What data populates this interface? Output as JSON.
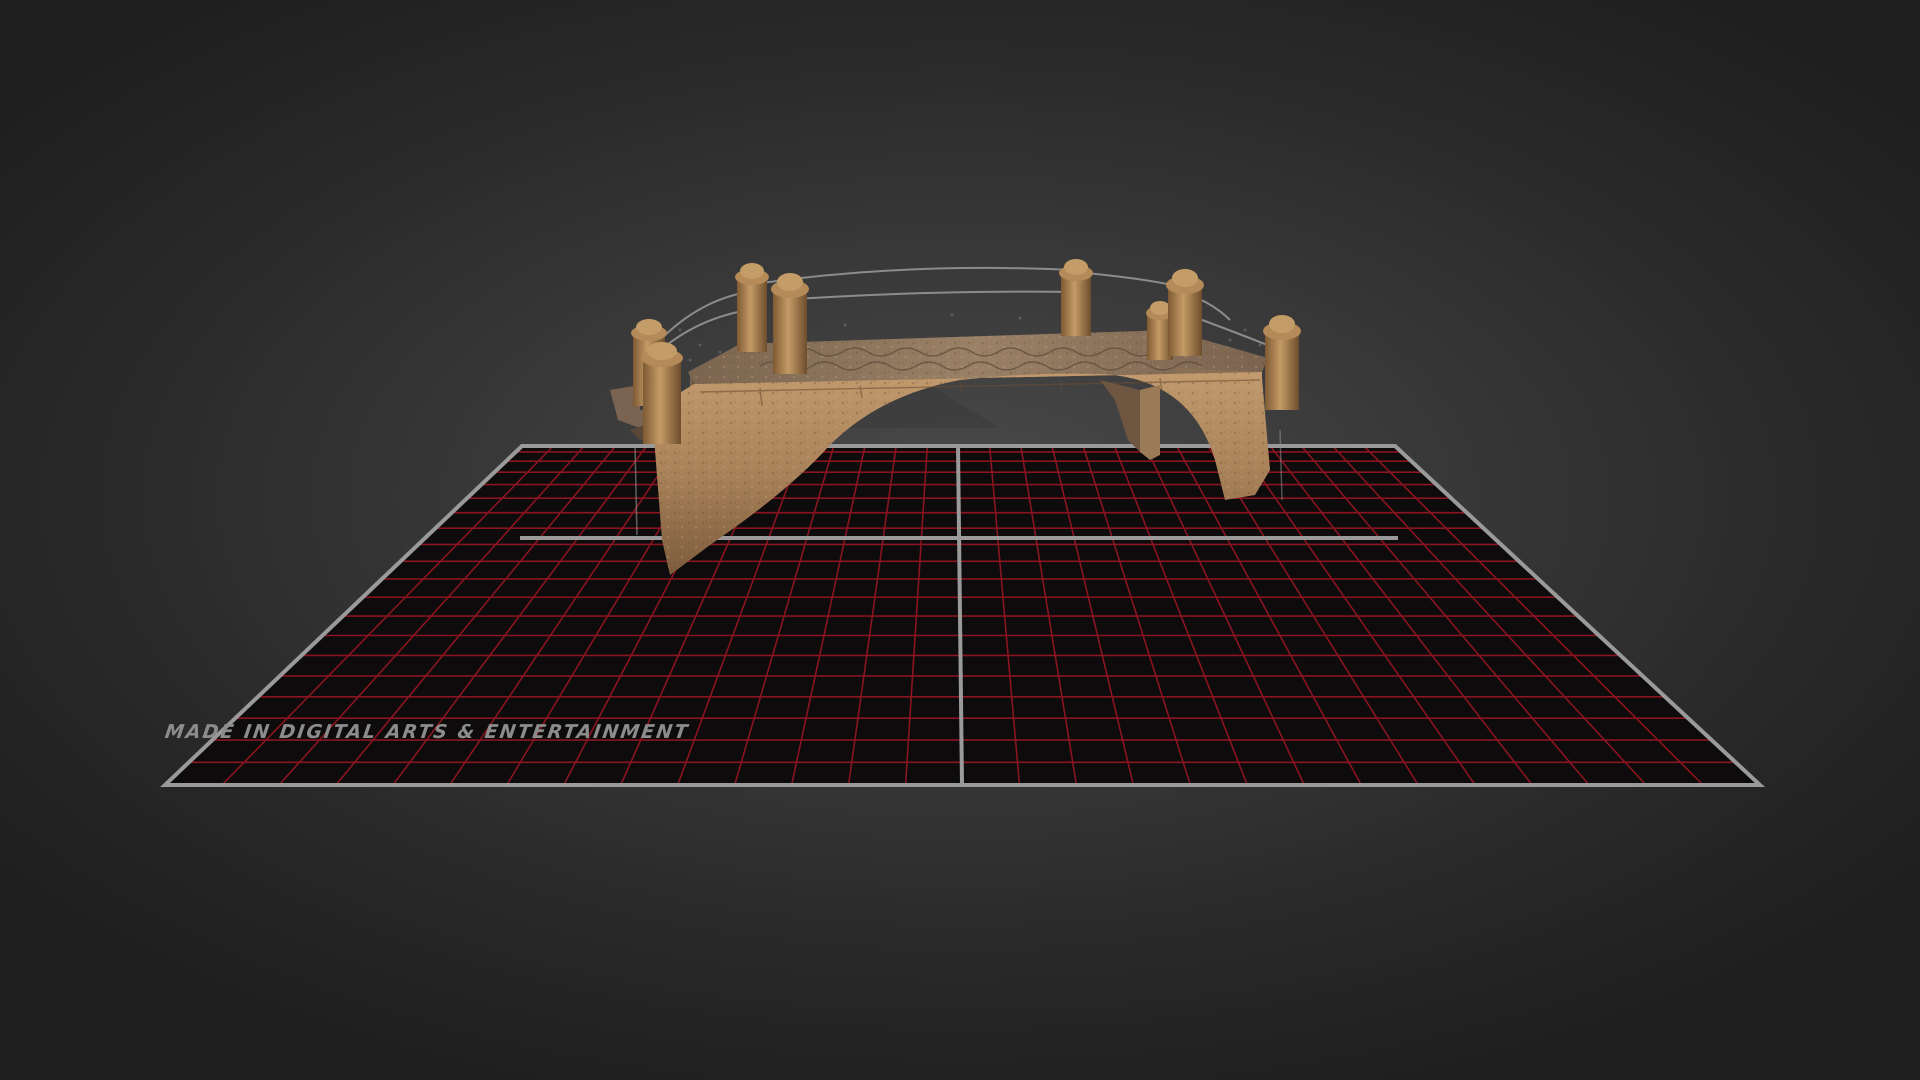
{
  "viewer": {
    "floor_label": "MADE IN DIGITAL ARTS & ENTERTAINMENT"
  },
  "colors": {
    "background_center": "#4a4a4a",
    "background_edge": "#1f1f1f",
    "floor_fill": "#0d0b0c",
    "grid_line": "#8a1420",
    "floor_border": "#9a9a9a",
    "stone_light": "#b08a62",
    "stone_dark": "#6e5238",
    "pillar": "#a27a4c",
    "label_text": "#8c8c8c"
  },
  "icons": {
    "model": "bridge-model-icon"
  }
}
